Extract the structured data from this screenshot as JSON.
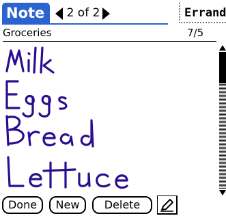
{
  "title_bar": {
    "app_label": "Note",
    "page_indicator": "2 of 2",
    "category": "Errands"
  },
  "memo": {
    "title": "Groceries",
    "date": "7/5",
    "ink_lines": [
      "Milk",
      "Eggs",
      "Bread",
      "Lettuce"
    ],
    "ink_color": "#2a0e8f"
  },
  "buttons": {
    "done": "Done",
    "new": "New",
    "delete": "Delete"
  },
  "colors": {
    "title_bar": "#2b63cf"
  },
  "icons": {
    "prev": "left-triangle-icon",
    "next": "right-triangle-icon",
    "pen": "pen-icon",
    "scroll_up": "up-triangle-icon",
    "scroll_down": "down-triangle-icon"
  }
}
